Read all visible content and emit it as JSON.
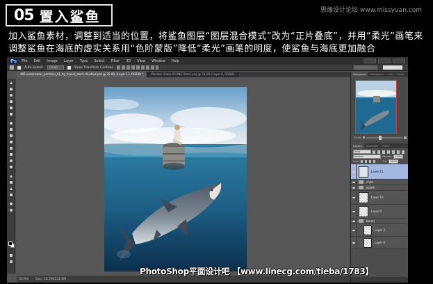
{
  "header": {
    "step_number": "05",
    "step_title": "置入鲨鱼",
    "watermark": "思缘设计论坛 www.missyuan.com",
    "description": "加入鲨鱼素材，调整到适当的位置，将鲨鱼图层“图层混合模式”改为“正片叠底”，并用“柔光”画笔来调整鲨鱼在海底的虚实关系用“色阶蒙版”降低“柔光”画笔的明度，使鲨鱼与海底更加融合"
  },
  "app": {
    "logo": "Ps",
    "menu": [
      "File",
      "Edit",
      "Image",
      "Layer",
      "Type",
      "Select",
      "Filter",
      "3D",
      "View",
      "Window",
      "Help"
    ],
    "options": {
      "auto_select": "Auto-Select:",
      "group_value": "Group",
      "show_transform": "Show Transform Controls"
    },
    "document_tabs": [
      {
        "label": "486 underwater_partition_01_by_fcpest_stock-d4x4bof.psd @ 35.9% (Layer 11, RGB/8) *",
        "active": true
      },
      {
        "label": "Monster Shark 03 PNG Stock.png @ 33.3% (Layer 0, RGB/8)",
        "active": false
      }
    ],
    "status": {
      "zoom": "35.9%",
      "doc_info": "Doc: 18.7M/131.8M"
    }
  },
  "navigator": {
    "tabs": [
      "Navigator",
      "Histogram",
      "Info",
      "Color"
    ],
    "zoom": "35.9%"
  },
  "layers": {
    "tabs": [
      "Layers",
      "Channels",
      "Paths"
    ],
    "kind_label": "Kind",
    "blend_mode": "Normal",
    "opacity_label": "Opacity:",
    "opacity_value": "100%",
    "lock_label": "Lock:",
    "fill_label": "Fill:",
    "fill_value": "100%",
    "items": [
      {
        "name": "Layer 11",
        "selected": true,
        "type": "layer"
      },
      {
        "name": "child",
        "selected": false,
        "type": "group"
      },
      {
        "name": "splash",
        "selected": false,
        "type": "group"
      },
      {
        "name": "Layer 10",
        "selected": false,
        "type": "layer"
      },
      {
        "name": "Layer 9",
        "selected": false,
        "type": "layer"
      },
      {
        "name": "barrel",
        "selected": false,
        "type": "group"
      },
      {
        "name": "Layer 3",
        "selected": false,
        "type": "layer",
        "indent": true
      },
      {
        "name": "Layer 4",
        "selected": false,
        "type": "layer",
        "indent": true
      }
    ]
  },
  "caption": "PhotoShop平面设计吧 【www.linecg.com/tieba/1783】"
}
